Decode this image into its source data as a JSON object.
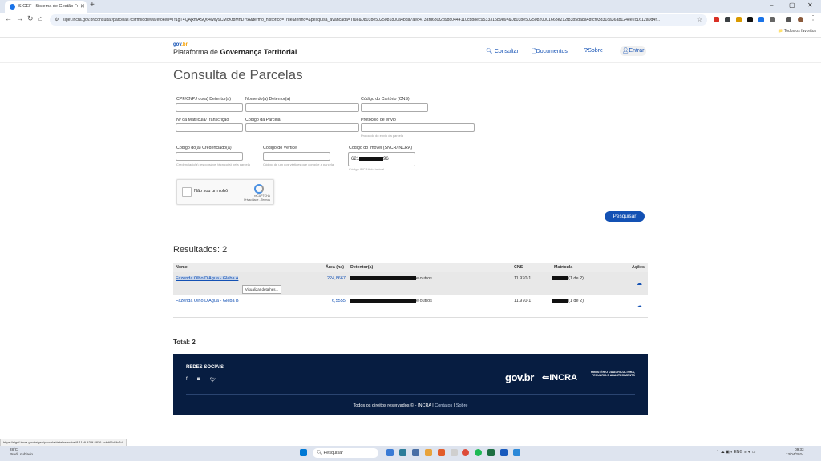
{
  "browser": {
    "tab_title": "SIGEF - Sistema de Gestão Fu...",
    "tab_close": "✕",
    "new_tab": "+",
    "url": "sigef.incra.gov.br/consultar/parcelas?csrfmiddlewaretoken=Tf1gT4QAjxmASQ64wxy9CMcKr8MhD7tA&termo_historico=True&termo=&pesquisa_avancada=True&0803be5025081800a4bda7aed473afd630f2d9dc0444110cbb8ec953331589e6=&0803be50250820001663e212f83b5da8a48fcf03d31ca36ab124ee2c1612a0d4f...",
    "bookmarks": "Todos os favoritos",
    "win_min": "–",
    "win_max": "▢",
    "win_close": "✕"
  },
  "site": {
    "gov_brand": "gov",
    "gov_brand_br": ".br",
    "platform_prefix": "Plataforma de ",
    "platform_name": "Governança Territorial",
    "nav": {
      "consultar": "Consultar",
      "documentos": "Documentos",
      "sobre": "Sobre",
      "entrar": "Entrar"
    }
  },
  "page": {
    "title": "Consulta de Parcelas"
  },
  "form": {
    "cpf_label": "CPF/CNPJ do(a) Detentor(a)",
    "nome_label": "Nome do(a) Detentor(a)",
    "cns_label": "Código do Cartório (CNS)",
    "matricula_label": "Nº da Matrícula/Transcrição",
    "parcela_label": "Código da Parcela",
    "protocolo_label": "Protocolo de envio",
    "protocolo_hint": "Protocolo do envio da parcela",
    "credenciado_label": "Código do(a) Credenciado(a)",
    "credenciado_hint": "Credenciado(a) responsável técnico(a) pela parcela",
    "vertice_label": "Código do Vértice",
    "vertice_hint": "Código de um dos vértices que compõe a parcela",
    "imovel_label": "Código do Imóvel (SNCR/INCRA)",
    "imovel_value_start": "621",
    "imovel_value_end": "96",
    "imovel_hint": "Código INCRA do imóvel",
    "captcha_label": "Não sou um robô",
    "captcha_brand": "reCAPTCHA",
    "captcha_terms": "Privacidade - Termos",
    "search_button": "Pesquisar"
  },
  "results": {
    "title": "Resultados: 2",
    "headers": {
      "nome": "Nome",
      "area": "Área (ha)",
      "detentor": "Detentor(a)",
      "cns": "CNS",
      "matricula": "Matrícula",
      "acoes": "Ações"
    },
    "rows": [
      {
        "nome": "Fazenda Olho D'Agua - Gleba A",
        "area": "224,8667",
        "detentor_suffix": "e outros",
        "cns": "11.970-1",
        "matricula_suffix": "(1 de 2)"
      },
      {
        "nome": "Fazenda Olho D'Agua - Gleba B",
        "area": "6,5555",
        "detentor_suffix": "e outros",
        "cns": "11.970-1",
        "matricula_suffix": "(1 de 2)"
      }
    ],
    "tooltip": "Visualizar detalhes...",
    "total": "Total: 2"
  },
  "footer": {
    "redes_sociais": "REDES SOCIAIS",
    "social_icons": [
      "facebook-icon",
      "instagram-icon",
      "twitter-icon"
    ],
    "govbr": "gov.br",
    "incra": "INCRA",
    "ministerio": "MINISTÉRIO DA AGRICULTURA, PECUÁRIA E ABASTECIMENTO",
    "copyright": "Todos os direitos reservados © - INCRA | ",
    "contatos": "Contatos",
    "sep": " | ",
    "sobre": "Sobre"
  },
  "status_url": "https://sigef.incra.gov.br/geo/parcela/detalhe/active/8-11c9-433f-8816-ccbd65d1fc7d/",
  "taskbar": {
    "weather_temp": "28°C",
    "weather_desc": "Predi. nublado",
    "search_placeholder": "Pesquisar",
    "lang": "ENG",
    "time": "09:33",
    "date": "13/04/2024"
  },
  "colors": {
    "brand_blue": "#1351b4",
    "footer_bg": "#071d41"
  }
}
